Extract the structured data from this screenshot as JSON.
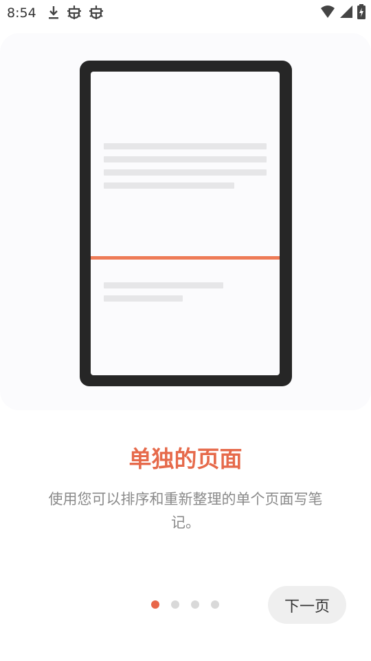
{
  "status_bar": {
    "time": "8:54",
    "left_icons": [
      "download-icon",
      "bug-icon",
      "bug-icon"
    ],
    "right_icons": [
      "wifi-icon",
      "cellular-signal-icon",
      "battery-charging-icon"
    ]
  },
  "illustration": {
    "device": "tablet",
    "accent_color": "#ee7b57"
  },
  "onboarding": {
    "title": "单独的页面",
    "description": "使用您可以排序和重新整理的单个页面写笔记。",
    "pager": {
      "total": 4,
      "current": 1
    },
    "next_label": "下一页"
  },
  "colors": {
    "title": "#e66a4b",
    "active_dot": "#e8674a",
    "inactive_dot": "#d9d9d9"
  }
}
